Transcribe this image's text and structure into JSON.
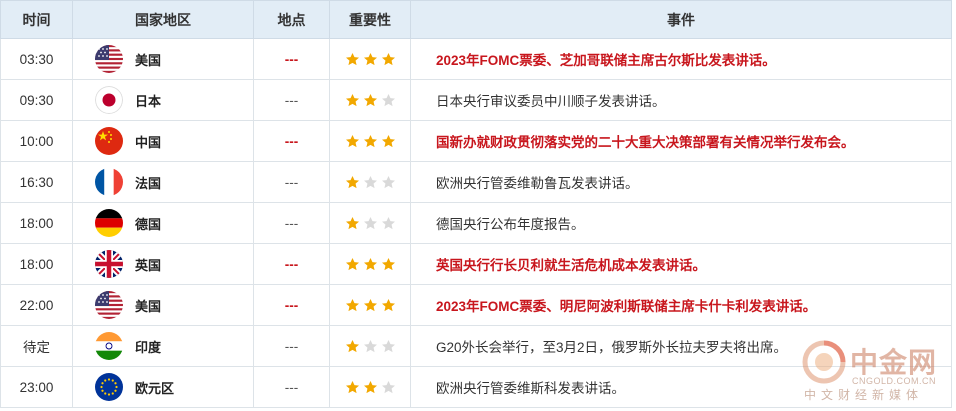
{
  "headers": {
    "time": "时间",
    "country": "国家地区",
    "location": "地点",
    "importance": "重要性",
    "event": "事件"
  },
  "colors": {
    "header_bg": "#e2edf6",
    "highlight_red": "#c8161d",
    "star_gold": "#f2a800",
    "star_empty": "#d9d9d9"
  },
  "rows": [
    {
      "time": "03:30",
      "country": "美国",
      "flag": "us-flag-icon",
      "location": "---",
      "stars": 3,
      "event": "2023年FOMC票委、芝加哥联储主席古尔斯比发表讲话。",
      "highlight": true
    },
    {
      "time": "09:30",
      "country": "日本",
      "flag": "japan-flag-icon",
      "location": "---",
      "stars": 2,
      "event": "日本央行审议委员中川顺子发表讲话。",
      "highlight": false
    },
    {
      "time": "10:00",
      "country": "中国",
      "flag": "china-flag-icon",
      "location": "---",
      "stars": 3,
      "event": "国新办就财政贯彻落实党的二十大重大决策部署有关情况举行发布会。",
      "highlight": true
    },
    {
      "time": "16:30",
      "country": "法国",
      "flag": "france-flag-icon",
      "location": "---",
      "stars": 1,
      "event": "欧洲央行管委维勒鲁瓦发表讲话。",
      "highlight": false
    },
    {
      "time": "18:00",
      "country": "德国",
      "flag": "germany-flag-icon",
      "location": "---",
      "stars": 1,
      "event": "德国央行公布年度报告。",
      "highlight": false
    },
    {
      "time": "18:00",
      "country": "英国",
      "flag": "uk-flag-icon",
      "location": "---",
      "stars": 3,
      "event": "英国央行行长贝利就生活危机成本发表讲话。",
      "highlight": true
    },
    {
      "time": "22:00",
      "country": "美国",
      "flag": "us-flag-icon",
      "location": "---",
      "stars": 3,
      "event": "2023年FOMC票委、明尼阿波利斯联储主席卡什卡利发表讲话。",
      "highlight": true
    },
    {
      "time": "待定",
      "country": "印度",
      "flag": "india-flag-icon",
      "location": "---",
      "stars": 1,
      "event": "G20外长会举行，至3月2日，俄罗斯外长拉夫罗夫将出席。",
      "highlight": false
    },
    {
      "time": "23:00",
      "country": "欧元区",
      "flag": "eu-flag-icon",
      "location": "---",
      "stars": 2,
      "event": "欧洲央行管委维斯科发表讲话。",
      "highlight": false
    }
  ],
  "watermark": {
    "brand": "中金网",
    "domain": "CNGOLD.COM.CN",
    "slogan": "中文财经新媒体"
  }
}
